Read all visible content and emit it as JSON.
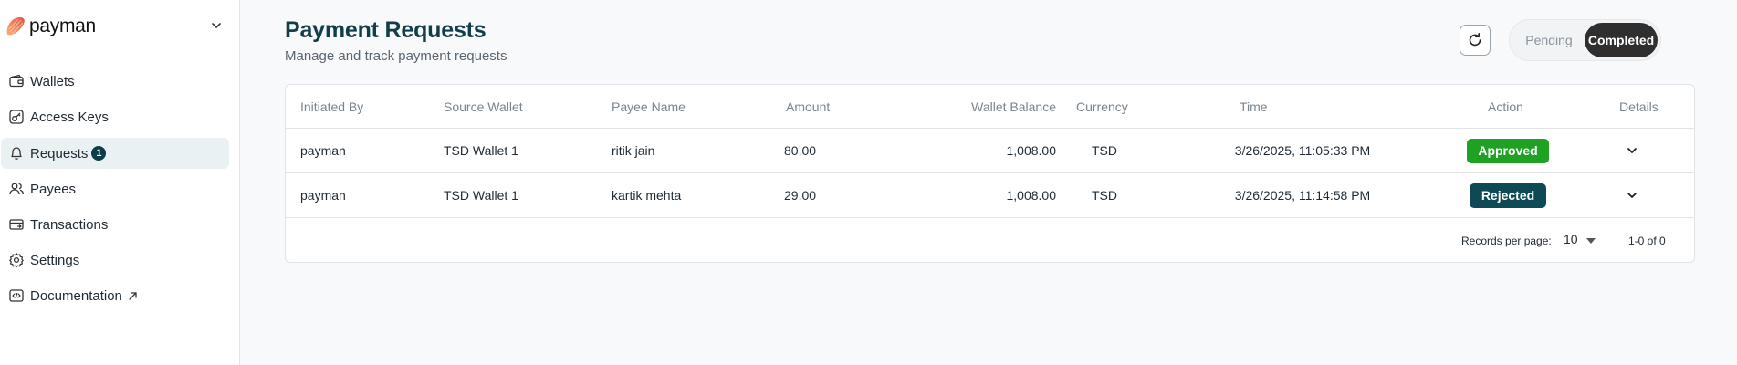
{
  "brand": {
    "name": "payman"
  },
  "sidebar": {
    "items": [
      {
        "label": "Wallets",
        "icon": "wallet-icon",
        "active": false
      },
      {
        "label": "Access Keys",
        "icon": "key-icon",
        "active": false
      },
      {
        "label": "Requests",
        "icon": "bell-icon",
        "active": true,
        "badge": "1"
      },
      {
        "label": "Payees",
        "icon": "users-icon",
        "active": false
      },
      {
        "label": "Transactions",
        "icon": "transactions-icon",
        "active": false
      },
      {
        "label": "Settings",
        "icon": "gear-icon",
        "active": false
      },
      {
        "label": "Documentation",
        "icon": "code-doc-icon",
        "active": false,
        "external": true
      }
    ]
  },
  "header": {
    "title": "Payment Requests",
    "subtitle": "Manage and track payment requests",
    "refresh_icon": "refresh-icon"
  },
  "tabs": {
    "pending_label": "Pending",
    "completed_label": "Completed",
    "selected": "Completed"
  },
  "table": {
    "columns": [
      "Initiated By",
      "Source Wallet",
      "Payee Name",
      "Amount",
      "Wallet Balance",
      "Currency",
      "Time",
      "Action",
      "Details"
    ],
    "rows": [
      {
        "initiated_by": "payman",
        "source_wallet": "TSD Wallet 1",
        "payee_name": "ritik jain",
        "amount": "80.00",
        "wallet_balance": "1,008.00",
        "currency": "TSD",
        "time": "3/26/2025, 11:05:33 PM",
        "action": "Approved"
      },
      {
        "initiated_by": "payman",
        "source_wallet": "TSD Wallet 1",
        "payee_name": "kartik mehta",
        "amount": "29.00",
        "wallet_balance": "1,008.00",
        "currency": "TSD",
        "time": "3/26/2025, 11:14:58 PM",
        "action": "Rejected"
      }
    ]
  },
  "pagination": {
    "records_per_page_label": "Records per page:",
    "records_per_page_value": "10",
    "range_text": "1-0 of 0"
  },
  "colors": {
    "approved": "#1fa224",
    "rejected": "#0d4a55",
    "title": "#123d4a",
    "active_nav_bg": "#e9f1f3"
  }
}
